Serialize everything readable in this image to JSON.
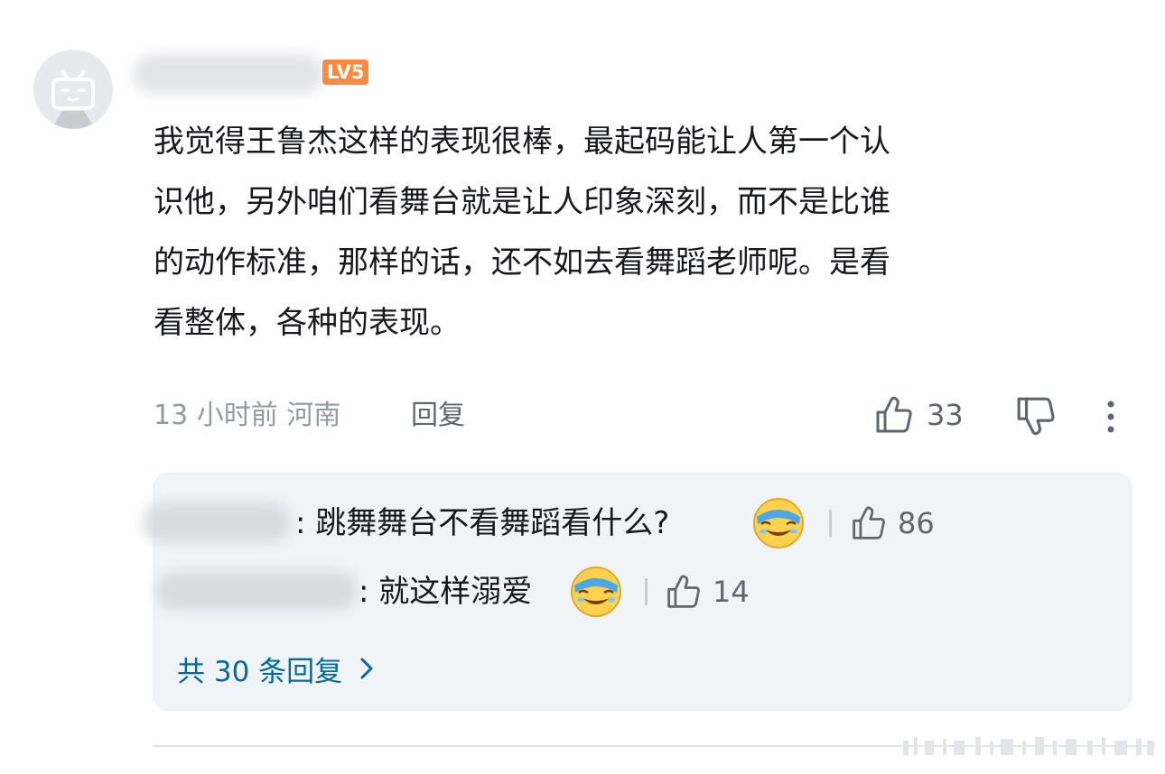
{
  "comment": {
    "level_badge": "LV5",
    "text_lines": [
      "我觉得王鲁杰这样的表现很棒，最起码能让人第一个认",
      "识他，另外咱们看舞台就是让人印象深刻，而不是比谁",
      "的动作标准，那样的话，还不如去看舞蹈老师呢。是看",
      "看整体，各种的表现。"
    ],
    "time_location": "13 小时前 河南",
    "reply_label": "回复",
    "like_count": "33"
  },
  "replies": [
    {
      "text": ": 跳舞舞台不看舞蹈看什么?",
      "like_count": "86",
      "emoji": "facepalm-laugh-emoji"
    },
    {
      "text": ": 就这样溺爱",
      "like_count": "14",
      "emoji": "facepalm-laugh-emoji"
    }
  ],
  "total_replies_label": "共 30 条回复",
  "colors": {
    "level_badge": "#ff8a3d",
    "link_blue": "#00699d",
    "reply_box_bg": "#f1f4f7",
    "muted_text": "#9499a0"
  },
  "icons": [
    "avatar-placeholder-icon",
    "thumbs-up-icon",
    "thumbs-down-icon",
    "more-vertical-icon",
    "chevron-right-icon"
  ]
}
